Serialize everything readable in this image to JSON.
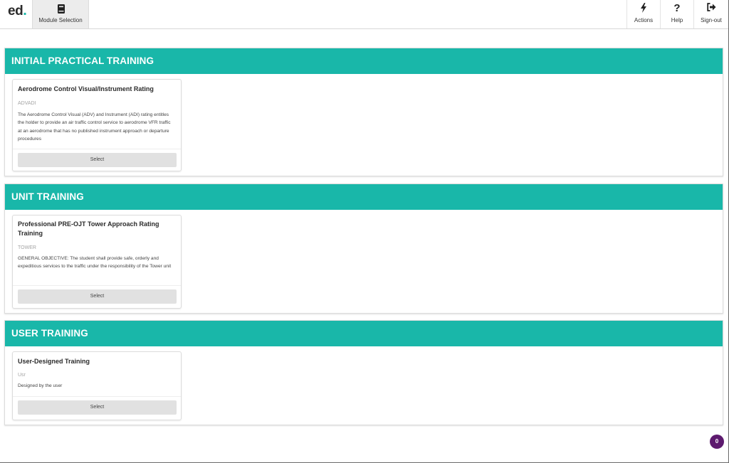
{
  "header": {
    "logo_text": "ed",
    "logo_dot": ".",
    "nav_tab_label": "Module Selection",
    "actions": [
      {
        "label": "Actions",
        "icon": "lightning-icon",
        "glyph": "ϟ"
      },
      {
        "label": "Help",
        "icon": "question-icon",
        "glyph": "?"
      },
      {
        "label": "Sign-out",
        "icon": "sign-out-icon",
        "glyph": "➜"
      }
    ]
  },
  "sections": [
    {
      "title": "INITIAL PRACTICAL TRAINING",
      "card": {
        "title": "Aerodrome Control Visual/Instrument Rating",
        "code": "ADVADI",
        "description": "The Aerodrome Control Visual (ADV) and Instrument (ADI) rating entitles the holder to provide an air traffic control service to aerodrome VFR traffic at an aerodrome that has no published instrument approach or departure procedures",
        "button": "Select"
      }
    },
    {
      "title": "UNIT TRAINING",
      "card": {
        "title": "Professional PRE-OJT Tower Approach Rating Training",
        "code": "TOWER",
        "description": "GENERAL OBJECTIVE: The student shall provide safe, orderly and expeditious services to the traffic under the responsibility of the Tower unit",
        "button": "Select"
      }
    },
    {
      "title": "USER TRAINING",
      "card": {
        "title": "User-Designed Training",
        "code": "Usr",
        "description": "Designed by the user",
        "button": "Select"
      }
    }
  ],
  "notification_badge": "0",
  "colors": {
    "accent": "#19b7a9",
    "badge": "#5d1a6e"
  }
}
